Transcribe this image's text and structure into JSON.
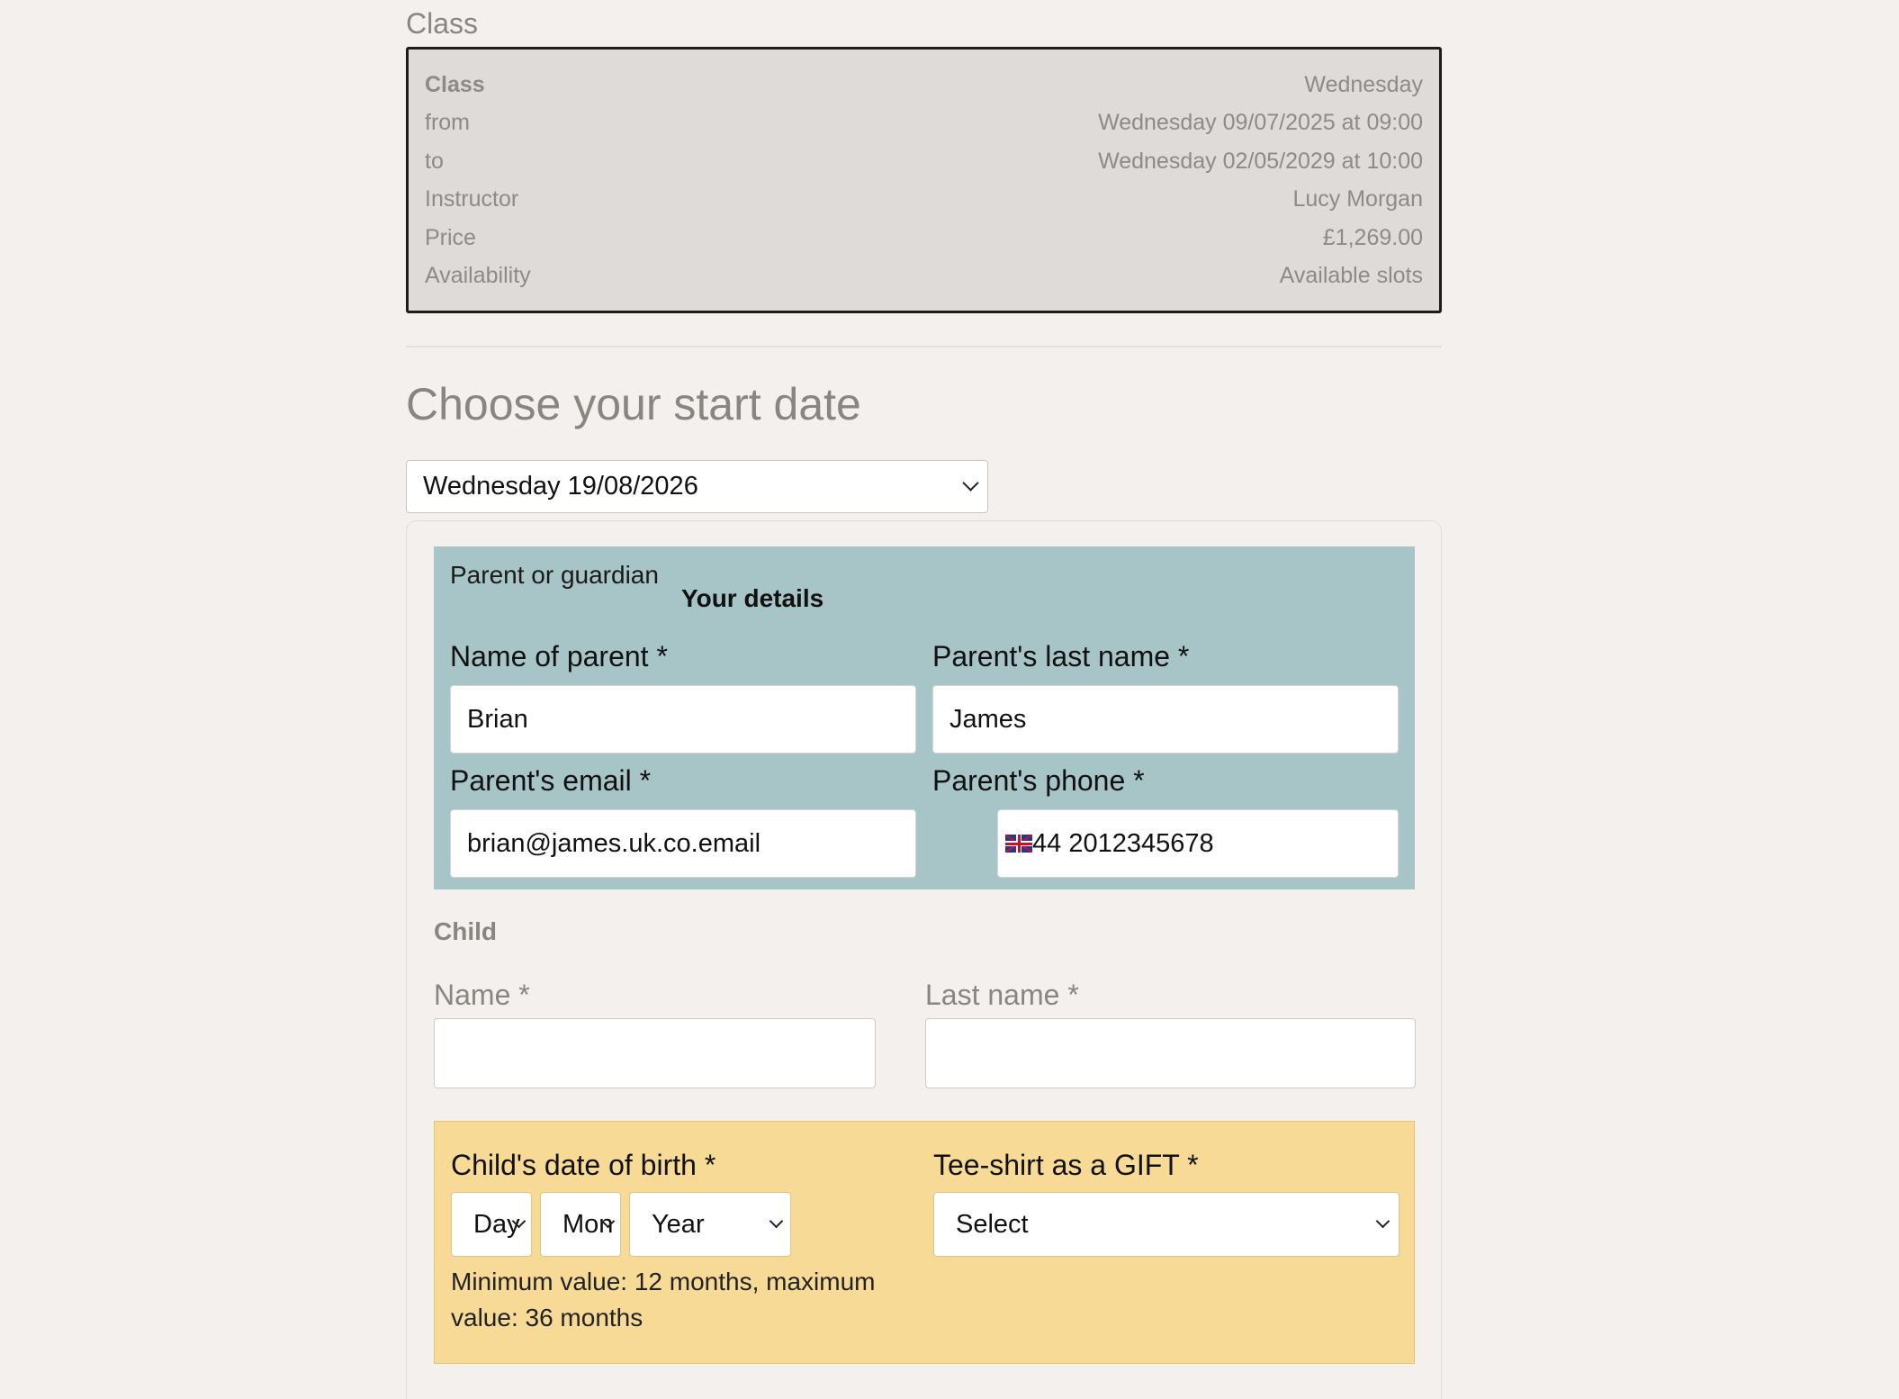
{
  "class_section": {
    "label": "Class",
    "rows": [
      {
        "key": "Class",
        "value": "Wednesday"
      },
      {
        "key": "from",
        "value": "Wednesday 09/07/2025 at 09:00"
      },
      {
        "key": "to",
        "value": "Wednesday 02/05/2029 at 10:00"
      },
      {
        "key": "Instructor",
        "value": "Lucy Morgan"
      },
      {
        "key": "Price",
        "value": "£1,269.00"
      },
      {
        "key": "Availability",
        "value": "Available slots"
      }
    ]
  },
  "start_date": {
    "title": "Choose your start date",
    "selected": "Wednesday 19/08/2026"
  },
  "parent": {
    "section_label": "Parent or guardian",
    "subtitle": "Your details",
    "first_name_label": "Name of parent *",
    "first_name_value": "Brian",
    "last_name_label": "Parent's last name *",
    "last_name_value": "James",
    "email_label": "Parent's email *",
    "email_value": "brian@james.uk.co.email",
    "phone_label": "Parent's phone *",
    "phone_value": "44 2012345678",
    "phone_country_icon": "uk-flag-icon"
  },
  "child": {
    "heading": "Child",
    "name_label": "Name *",
    "name_value": "",
    "last_name_label": "Last name *",
    "last_name_value": "",
    "dob_label": "Child's date of birth *",
    "day_placeholder": "Day",
    "month_placeholder": "Mon",
    "year_placeholder": "Year",
    "dob_hint": "Minimum value: 12 months, maximum value: 36 months",
    "tshirt_label": "Tee-shirt as a GIFT *",
    "tshirt_value": "Select"
  },
  "colors": {
    "page_bg": "#f3f0ed",
    "parent_box": "#a7c5c7",
    "dob_box": "#f7da95",
    "muted_text": "#8a8580"
  }
}
